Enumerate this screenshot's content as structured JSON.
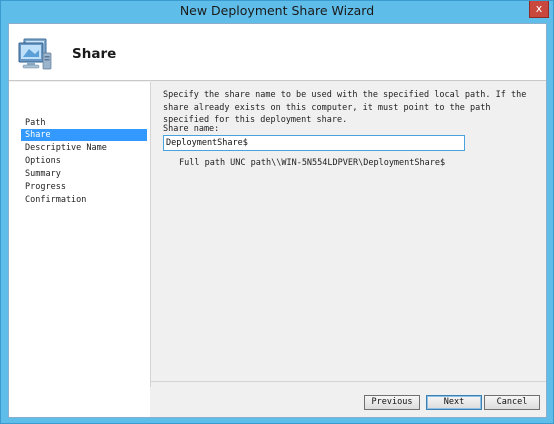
{
  "window": {
    "title": "New Deployment Share Wizard",
    "close_label": "x"
  },
  "header": {
    "title": "Share",
    "icon": "computer-network-icon"
  },
  "nav": {
    "items": [
      {
        "label": "Path",
        "active": false
      },
      {
        "label": "Share",
        "active": true
      },
      {
        "label": "Descriptive Name",
        "active": false
      },
      {
        "label": "Options",
        "active": false
      },
      {
        "label": "Summary",
        "active": false
      },
      {
        "label": "Progress",
        "active": false
      },
      {
        "label": "Confirmation",
        "active": false
      }
    ]
  },
  "content": {
    "description": "Specify the share name to be used with the specified local path.  If the share already exists on this computer, it must point to the path specified for this deployment share.",
    "share_name_label": "Share name:",
    "share_name_value": "DeploymentShare$",
    "full_path_text": "Full path UNC path\\\\WIN-5N554LDPVER\\DeploymentShare$"
  },
  "footer": {
    "previous_label": "Previous",
    "next_label": "Next",
    "cancel_label": "Cancel"
  },
  "colors": {
    "frame": "#5fbde9",
    "selection": "#3399ff",
    "close": "#c9483e"
  }
}
